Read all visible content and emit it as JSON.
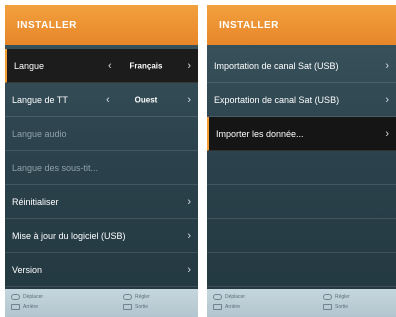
{
  "left_panel": {
    "title": "INSTALLER",
    "rows": [
      {
        "label": "Langue",
        "value": "Français",
        "has_value": true,
        "highlighted": true,
        "dim": false
      },
      {
        "label": "Langue de TT",
        "value": "Ouest",
        "has_value": true,
        "highlighted": false,
        "dim": false
      },
      {
        "label": "Langue audio",
        "dim": true
      },
      {
        "label": "Langue des sous-tit...",
        "dim": true
      },
      {
        "label": "Réinitialiser",
        "has_arrow": true
      },
      {
        "label": "Mise à jour du logiciel (USB)",
        "has_arrow": true
      },
      {
        "label": "Version",
        "has_arrow": true
      }
    ],
    "footer": {
      "move": "Déplacer",
      "adjust": "Régler",
      "back": "Arrière",
      "exit": "Sortie"
    }
  },
  "right_panel": {
    "title": "INSTALLER",
    "rows": [
      {
        "label": "Importation de canal Sat (USB)",
        "has_arrow": true
      },
      {
        "label": "Exportation de canal Sat (USB)",
        "has_arrow": true
      },
      {
        "label": "Importer les donnée...",
        "has_arrow": true,
        "selected": true
      }
    ],
    "footer": {
      "move": "Déplacer",
      "adjust": "Régler",
      "back": "Arrière",
      "exit": "Sortie"
    }
  },
  "colors": {
    "header": "#e7862a",
    "panel_bg": "#2c434d",
    "footer_bg": "#b8c9d2",
    "accent": "#f39c33"
  }
}
